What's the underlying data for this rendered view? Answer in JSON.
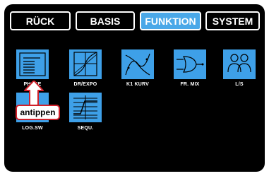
{
  "tabs": [
    {
      "label": "RÜCK",
      "active": false
    },
    {
      "label": "BASIS",
      "active": false
    },
    {
      "label": "FUNKTION",
      "active": true
    },
    {
      "label": "SYSTEM",
      "active": false
    }
  ],
  "menu": {
    "items": [
      {
        "label": "PHASE",
        "icon": "phase-icon"
      },
      {
        "label": "DR/EXPO",
        "icon": "dr-expo-icon"
      },
      {
        "label": "K1 KURV",
        "icon": "k1-curve-icon"
      },
      {
        "label": "FR. MIX",
        "icon": "free-mix-icon"
      },
      {
        "label": "L/S",
        "icon": "teacher-student-icon"
      },
      {
        "label": "LOG.SW",
        "icon": "logic-switch-icon"
      },
      {
        "label": "SEQU.",
        "icon": "sequencer-icon"
      }
    ]
  },
  "callout": {
    "label": "antippen"
  },
  "colors": {
    "background": "#000000",
    "tile": "#3ea0e8",
    "active_tab": "#4aa8e8",
    "callout_border": "#d0202a",
    "arrow": "#d0202a"
  }
}
